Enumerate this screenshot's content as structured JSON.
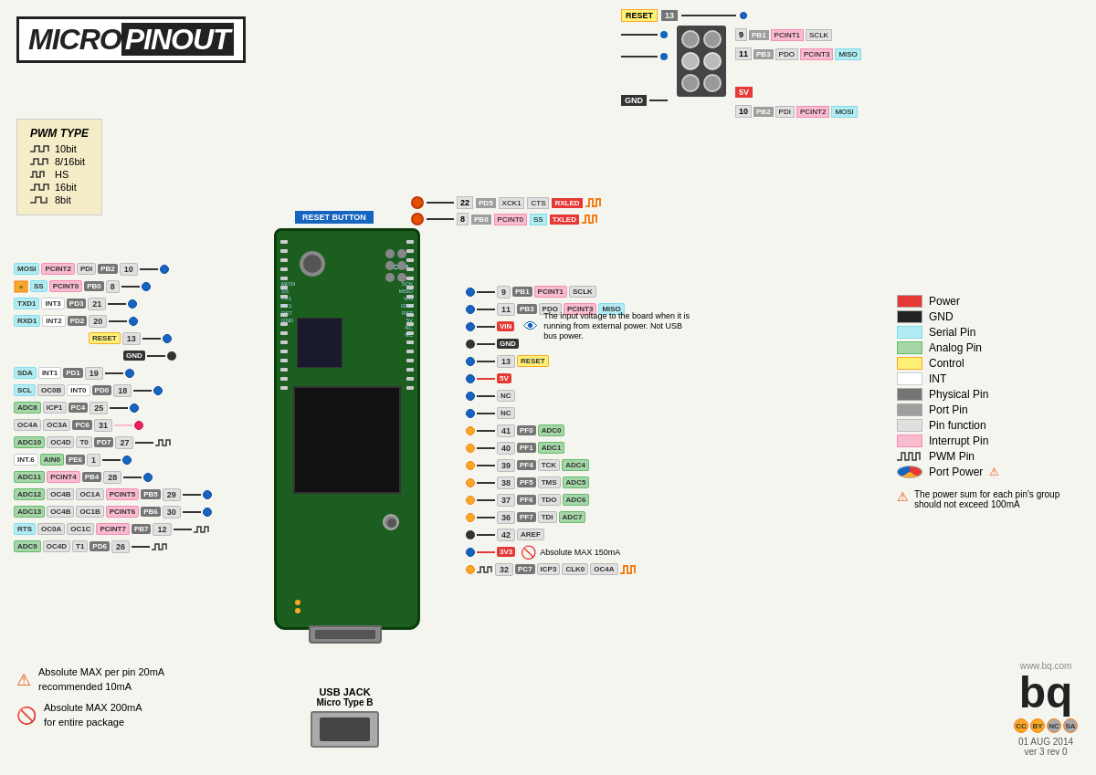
{
  "title": {
    "micro": "MICRO",
    "pinout": "PINOUT"
  },
  "pwm": {
    "title": "PWM TYPE",
    "items": [
      {
        "label": "10bit"
      },
      {
        "label": "8/16bit"
      },
      {
        "label": "HS"
      },
      {
        "label": "16bit"
      },
      {
        "label": "8bit"
      }
    ]
  },
  "legend": {
    "items": [
      {
        "label": "Power",
        "color": "#e53935"
      },
      {
        "label": "GND",
        "color": "#222222"
      },
      {
        "label": "Serial Pin",
        "color": "#b2ebf2"
      },
      {
        "label": "Analog Pin",
        "color": "#a5d6a7"
      },
      {
        "label": "Control",
        "color": "#fff176"
      },
      {
        "label": "INT",
        "color": "#ffffff"
      },
      {
        "label": "Physical Pin",
        "color": "#757575"
      },
      {
        "label": "Port Pin",
        "color": "#9e9e9e"
      },
      {
        "label": "Pin function",
        "color": "#e0e0e0"
      },
      {
        "label": "Interrupt Pin",
        "color": "#f8bbd0"
      },
      {
        "label": "PWM Pin",
        "color": "#ffffff"
      },
      {
        "label": "Port Power",
        "color": "#f9a825"
      }
    ]
  },
  "icsp": {
    "title": "ICSP",
    "pins": {
      "row1": {
        "num": "9",
        "port": "PB1",
        "func1": "PCINT1",
        "func2": "SCLK"
      },
      "row2": {
        "num": "11",
        "port": "PB3",
        "func1": "PDO",
        "func2": "PCINT3",
        "func3": "MISO"
      },
      "row3": {
        "num": "10",
        "port": "PB2",
        "func1": "PDI",
        "func2": "PCINT2",
        "func3": "MOSI"
      }
    },
    "reset": "RESET 13",
    "gnd": "GND",
    "vcc": "5V"
  },
  "top_pins": {
    "pin1": {
      "num": "22",
      "port": "PD5",
      "func1": "XCK1",
      "func2": "CTS",
      "func3": "RXLED"
    },
    "pin2": {
      "num": "8",
      "port": "PB0",
      "func1": "PCINT0",
      "func2": "SS",
      "func3": "TXLED"
    }
  },
  "left_pins": [
    {
      "num": "10",
      "port": "PB2",
      "funcs": [
        "MOSI",
        "PCINT2",
        "PDI"
      ],
      "connector": "blue"
    },
    {
      "num": "8",
      "port": "PB0",
      "funcs": [
        "SS",
        "PCINT0"
      ],
      "connector": "blue"
    },
    {
      "num": "21",
      "port": "PD3",
      "funcs": [
        "TXD1",
        "INT3"
      ],
      "connector": "blue"
    },
    {
      "num": "20",
      "port": "PD2",
      "funcs": [
        "RXD1",
        "INT2"
      ],
      "connector": "blue"
    },
    {
      "num": "13",
      "label": "RESET",
      "connector": "blue"
    },
    {
      "num": "",
      "label": "GND",
      "connector": "black"
    },
    {
      "num": "19",
      "port": "PD1",
      "funcs": [
        "SDA",
        "INT1"
      ],
      "connector": "blue"
    },
    {
      "num": "18",
      "port": "PD0",
      "funcs": [
        "SCL",
        "OC0B",
        "INT0"
      ],
      "connector": "blue"
    },
    {
      "num": "25",
      "port": "PC4",
      "funcs": [
        "ADC8",
        "ICP1"
      ],
      "connector": "blue"
    },
    {
      "num": "31",
      "port": "PC6",
      "funcs": [
        "OC4A",
        "OC3A"
      ],
      "connector": "pink"
    },
    {
      "num": "27",
      "port": "PD7",
      "funcs": [
        "ADC10",
        "OC4D",
        "T0"
      ],
      "connector": "blue"
    },
    {
      "num": "1",
      "port": "PE6",
      "funcs": [
        "INT.6",
        "AIN0"
      ],
      "connector": "blue"
    },
    {
      "num": "28",
      "port": "PB4",
      "funcs": [
        "ADC11",
        "PCINT4"
      ],
      "connector": "blue"
    },
    {
      "num": "29",
      "port": "PB5",
      "funcs": [
        "ADC12",
        "OC4B",
        "OC1A",
        "PCINT5"
      ],
      "connector": "blue"
    },
    {
      "num": "30",
      "port": "PB6",
      "funcs": [
        "ADC13",
        "OC4B",
        "OC1B",
        "PCINT6"
      ],
      "connector": "blue"
    },
    {
      "num": "12",
      "port": "PB7",
      "funcs": [
        "RTS",
        "OC0A",
        "OC1C",
        "PCINT7"
      ],
      "connector": "blue"
    },
    {
      "num": "26",
      "port": "PD6",
      "funcs": [
        "ADC9",
        "OC4D",
        "T1"
      ],
      "connector": "blue"
    }
  ],
  "right_pins": [
    {
      "num": "9",
      "port": "PB1",
      "funcs": [
        "PCINT1",
        "SCLK"
      ],
      "type": "sclk"
    },
    {
      "num": "11",
      "port": "PB3",
      "funcs": [
        "PDO",
        "PCINT3",
        "MISO"
      ],
      "type": "miso"
    },
    {
      "label": "VIN",
      "type": "power"
    },
    {
      "label": "GND",
      "type": "gnd"
    },
    {
      "num": "13",
      "label": "RESET",
      "type": "reset"
    },
    {
      "label": "5V",
      "type": "power5v"
    },
    {
      "label": "NC",
      "type": "nc"
    },
    {
      "label": "NC",
      "type": "nc"
    },
    {
      "num": "41",
      "port": "PF0",
      "funcs": [
        "ADC0"
      ],
      "type": "analog"
    },
    {
      "num": "40",
      "port": "PF1",
      "funcs": [
        "ADC1"
      ],
      "type": "analog"
    },
    {
      "num": "39",
      "port": "PF4",
      "funcs": [
        "TCK",
        "ADC4"
      ],
      "type": "analog"
    },
    {
      "num": "38",
      "port": "PF5",
      "funcs": [
        "TMS",
        "ADC5"
      ],
      "type": "analog"
    },
    {
      "num": "37",
      "port": "PF6",
      "funcs": [
        "TDO",
        "ADC6"
      ],
      "type": "analog"
    },
    {
      "num": "36",
      "port": "PF7",
      "funcs": [
        "TDI",
        "ADC7"
      ],
      "type": "analog"
    },
    {
      "num": "42",
      "label": "AREF",
      "type": "aref"
    },
    {
      "label": "3V3",
      "type": "power3v3"
    },
    {
      "num": "32",
      "port": "PC7",
      "funcs": [
        "ICP3",
        "CLK0",
        "OC4A"
      ],
      "type": "pwm"
    }
  ],
  "info_text": {
    "vin": "The input voltage to the board when it is running from external power. Not USB bus power."
  },
  "warnings": {
    "w1": "Absolute MAX per pin 20mA\nrecommended 10mA",
    "w2": "Absolute MAX 200mA\nfor entire package",
    "w3": "The power sum for each pin's\ngroup should not exceed 100mA"
  },
  "usb_jack": {
    "title": "USB JACK",
    "subtitle": "Micro Type B"
  },
  "footer": {
    "website": "www.bq.com",
    "date": "01 AUG 2014",
    "version": "ver 3 rev 0"
  },
  "board_labels": {
    "reset_button": "RESET BUTTON",
    "icsp_label": "ICSP",
    "mosi": "MOSI",
    "miso": "MISO",
    "sck": "SCK",
    "vin": "VIN",
    "gnd": "GND",
    "rst": "RST",
    "5v": "5V",
    "3v3": "3V3"
  }
}
